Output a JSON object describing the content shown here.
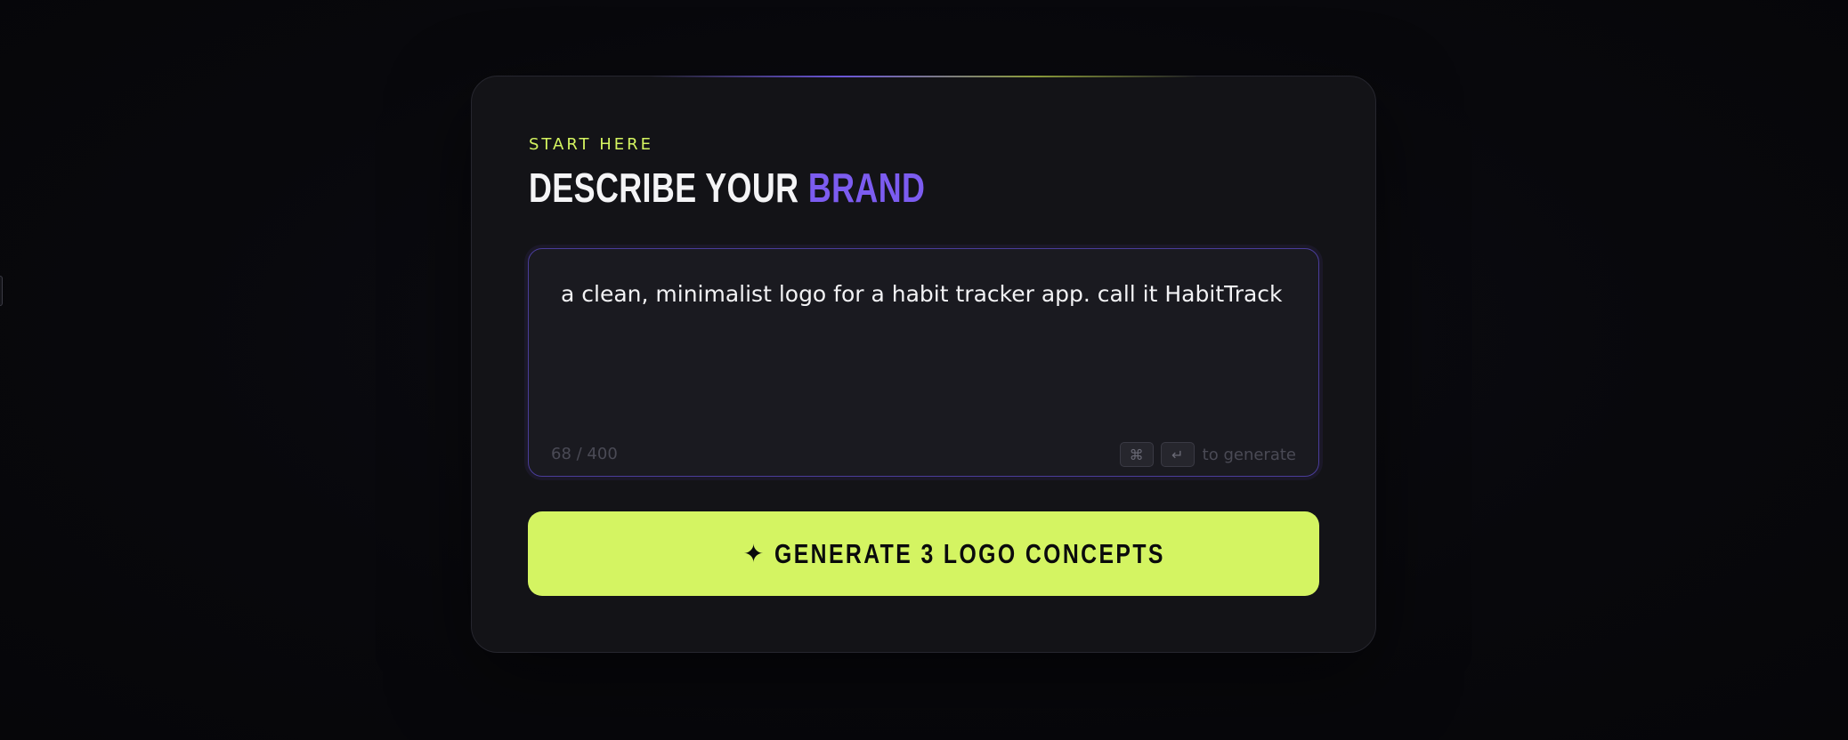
{
  "card": {
    "eyebrow": "START HERE",
    "title_prefix": "DESCRIBE YOUR ",
    "title_accent": "BRAND"
  },
  "prompt": {
    "value": "a clean, minimalist logo for a habit tracker app. call it HabitTrack",
    "char_count": "68 / 400",
    "shortcut_keys": [
      "⌘",
      "↵"
    ],
    "shortcut_hint": "to generate"
  },
  "generate": {
    "icon": "sparkle-icon",
    "label": "GENERATE 3 LOGO CONCEPTS"
  },
  "colors": {
    "accent_purple": "#7c5cf0",
    "accent_lime": "#d4f462",
    "background": "#07070b",
    "card": "#131317"
  }
}
